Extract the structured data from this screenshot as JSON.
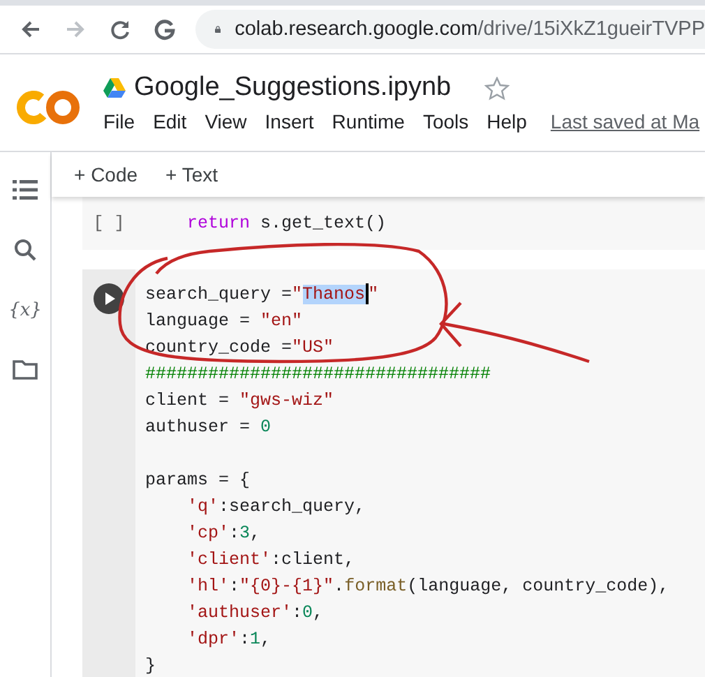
{
  "browser": {
    "host": "colab.research.google.com",
    "path": "/drive/15iXkZ1gueirTVPP"
  },
  "notebook": {
    "title": "Google_Suggestions.ipynb",
    "starred": false,
    "menu": [
      "File",
      "Edit",
      "View",
      "Insert",
      "Runtime",
      "Tools",
      "Help"
    ],
    "last_saved": "Last saved at Ma"
  },
  "sidebar": [
    {
      "kind": "toc"
    },
    {
      "kind": "search"
    },
    {
      "kind": "variables",
      "glyph": "{x}"
    },
    {
      "kind": "files"
    }
  ],
  "toolbar": [
    "+ Code",
    "+ Text"
  ],
  "cells": [
    {
      "prompt": "[ ]",
      "focused": false,
      "lines": [
        {
          "indent": true,
          "tokens": [
            {
              "kind": "keyword",
              "text": "return"
            },
            {
              "kind": "plain",
              "text": " s.get_text()"
            }
          ]
        }
      ]
    },
    {
      "focused": true,
      "lines": [
        {
          "indent": false,
          "tokens": [
            {
              "kind": "plain",
              "text": "search_query ="
            },
            {
              "kind": "string",
              "text": "\""
            },
            {
              "kind": "selection",
              "text": "Thanos"
            },
            {
              "kind": "string",
              "text": "\""
            }
          ]
        },
        {
          "indent": false,
          "tokens": [
            {
              "kind": "plain",
              "text": "language = "
            },
            {
              "kind": "string",
              "text": "\"en\""
            }
          ]
        },
        {
          "indent": false,
          "tokens": [
            {
              "kind": "plain",
              "text": "country_code ="
            },
            {
              "kind": "string",
              "text": "\"US\""
            }
          ]
        },
        {
          "indent": false,
          "tokens": [
            {
              "kind": "comment",
              "text": "#################################"
            }
          ]
        },
        {
          "indent": false,
          "tokens": [
            {
              "kind": "plain",
              "text": "client = "
            },
            {
              "kind": "string",
              "text": "\"gws-wiz\""
            }
          ]
        },
        {
          "indent": false,
          "tokens": [
            {
              "kind": "plain",
              "text": "authuser = "
            },
            {
              "kind": "number",
              "text": "0"
            }
          ]
        },
        {
          "kind": "blank"
        },
        {
          "indent": false,
          "tokens": [
            {
              "kind": "plain",
              "text": "params = {"
            }
          ]
        },
        {
          "indent": true,
          "tokens": [
            {
              "kind": "string",
              "text": "'q'"
            },
            {
              "kind": "plain",
              "text": ":search_query,"
            }
          ]
        },
        {
          "indent": true,
          "tokens": [
            {
              "kind": "string",
              "text": "'cp'"
            },
            {
              "kind": "plain",
              "text": ":"
            },
            {
              "kind": "number",
              "text": "3"
            },
            {
              "kind": "plain",
              "text": ","
            }
          ]
        },
        {
          "indent": true,
          "tokens": [
            {
              "kind": "string",
              "text": "'client'"
            },
            {
              "kind": "plain",
              "text": ":client,"
            }
          ]
        },
        {
          "indent": true,
          "tokens": [
            {
              "kind": "string",
              "text": "'hl'"
            },
            {
              "kind": "plain",
              "text": ":"
            },
            {
              "kind": "string",
              "text": "\"{0}-{1}\""
            },
            {
              "kind": "plain",
              "text": "."
            },
            {
              "kind": "func",
              "text": "format"
            },
            {
              "kind": "plain",
              "text": "(language, country_code),"
            }
          ]
        },
        {
          "indent": true,
          "tokens": [
            {
              "kind": "string",
              "text": "'authuser'"
            },
            {
              "kind": "plain",
              "text": ":"
            },
            {
              "kind": "number",
              "text": "0"
            },
            {
              "kind": "plain",
              "text": ","
            }
          ]
        },
        {
          "indent": true,
          "tokens": [
            {
              "kind": "string",
              "text": "'dpr'"
            },
            {
              "kind": "plain",
              "text": ":"
            },
            {
              "kind": "number",
              "text": "1"
            },
            {
              "kind": "plain",
              "text": ","
            }
          ]
        },
        {
          "indent": false,
          "tokens": [
            {
              "kind": "plain",
              "text": "}"
            }
          ]
        }
      ]
    }
  ]
}
